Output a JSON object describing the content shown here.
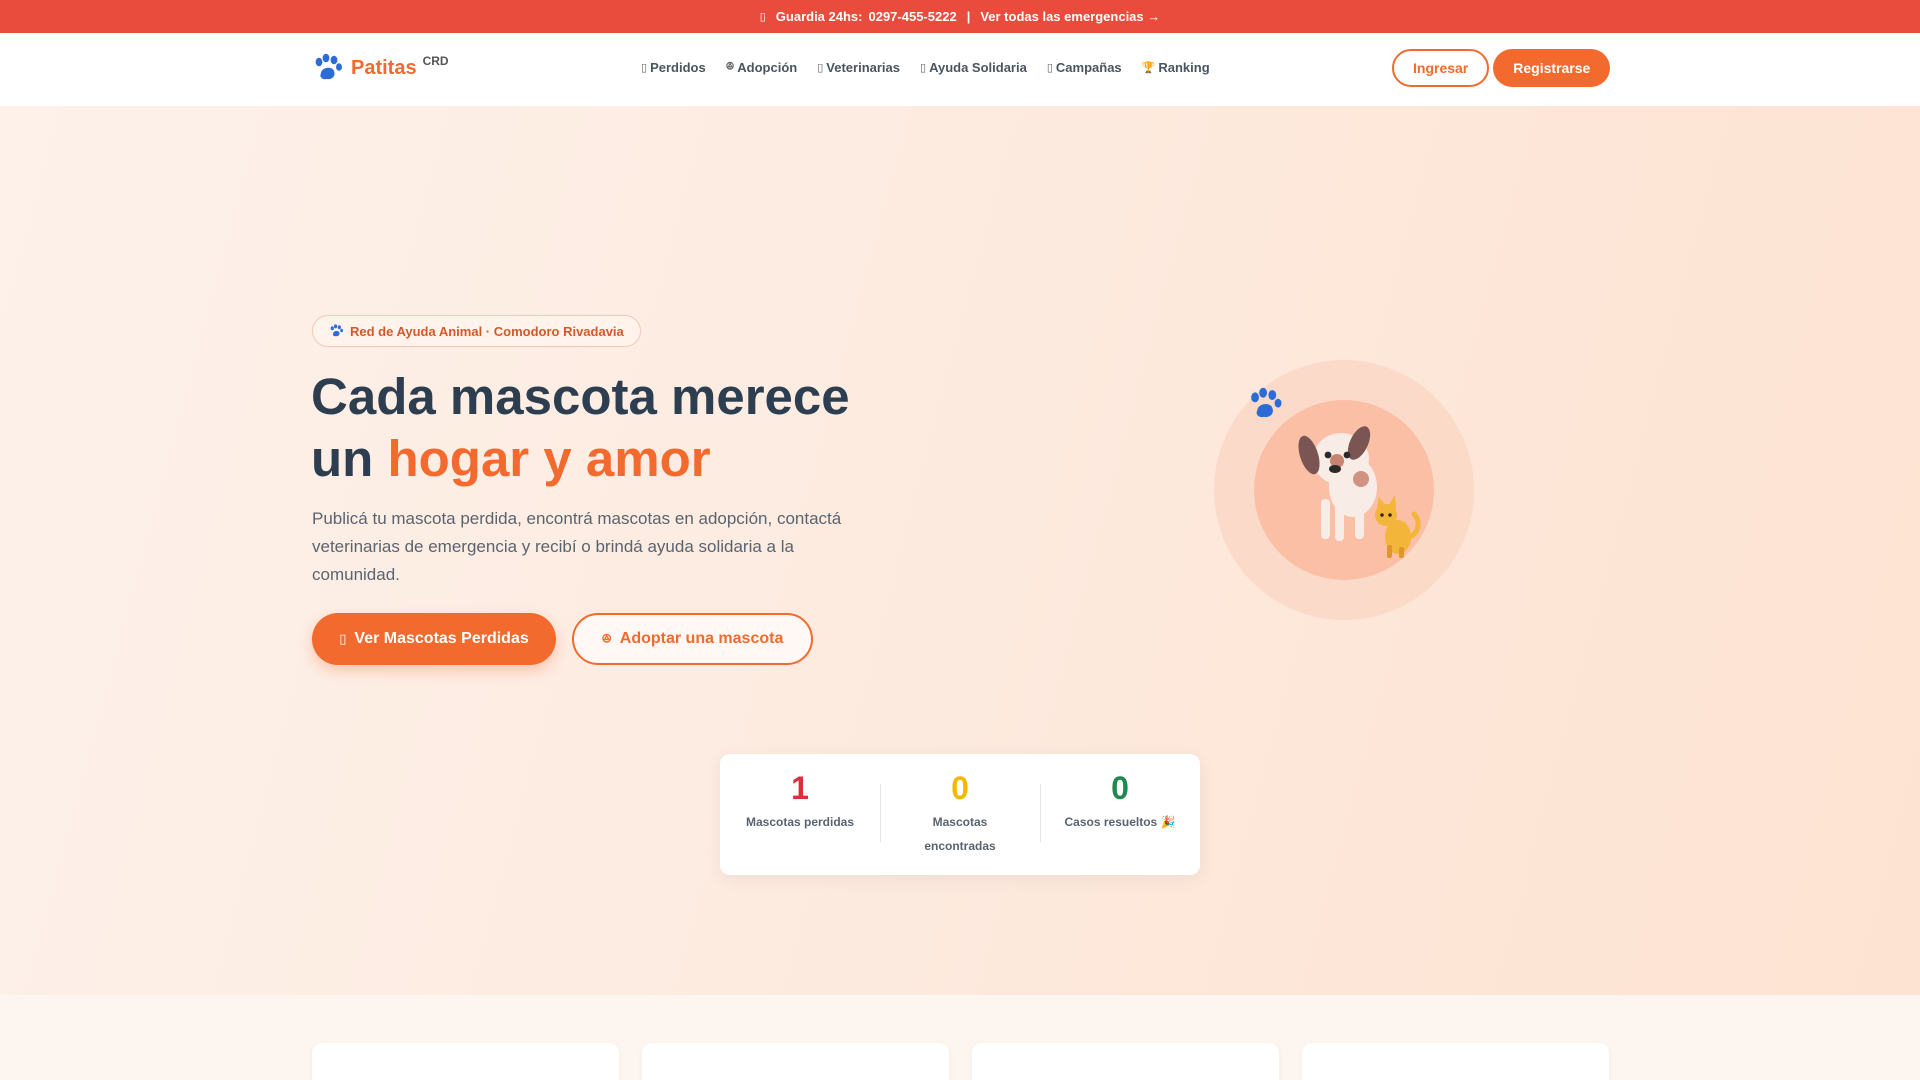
{
  "topbar": {
    "emergency_label": "Guardia 24hs:",
    "phone": "0297-455-5222",
    "separator": "|",
    "all_emergencies_link": "Ver todas las emergencias →"
  },
  "navbar": {
    "brand_name": "Patitas",
    "brand_sup": "CRD",
    "links": [
      {
        "label": "Perdidos",
        "glyph": "▯"
      },
      {
        "label": "Adopción",
        "glyph": "ꔮ"
      },
      {
        "label": "Veterinarias",
        "glyph": "▯"
      },
      {
        "label": "Ayuda Solidaria",
        "glyph": "▯"
      },
      {
        "label": "Campañas",
        "glyph": "▯"
      },
      {
        "label": "Ranking",
        "glyph": "🏆"
      }
    ],
    "login_label": "Ingresar",
    "register_label": "Registrarse"
  },
  "hero": {
    "badge": "Red de Ayuda Animal · Comodoro Rivadavia",
    "headline_line1": "Cada mascota merece",
    "headline_un": "un",
    "headline_accent": "hogar y amor",
    "lead": "Publicá tu mascota perdida, encontrá mascotas en adopción, contactá veterinarias de emergencia y recibí o brindá ayuda solidaria a la comunidad.",
    "cta_primary": "Ver Mascotas Perdidas",
    "cta_primary_glyph": "▯",
    "cta_secondary": "Adoptar una mascota",
    "cta_secondary_glyph": "ꔮ"
  },
  "stats": [
    {
      "value": "1",
      "label": "Mascotas perdidas",
      "color": "#dc2f3c"
    },
    {
      "value": "0",
      "label": "Mascotas encontradas",
      "color": "#f5b800"
    },
    {
      "value": "0",
      "label": "Casos resueltos 🎉",
      "color": "#1e8a4c"
    }
  ],
  "colors": {
    "brand": "#f26a2e",
    "topbar": "#e94b3c",
    "text_dark": "#2c3e50",
    "paw_blue": "#2d6cd6"
  },
  "icons": {
    "brand": "paw-icon",
    "badge": "paw-icon",
    "illustration": "dog-and-cat-illustration"
  }
}
